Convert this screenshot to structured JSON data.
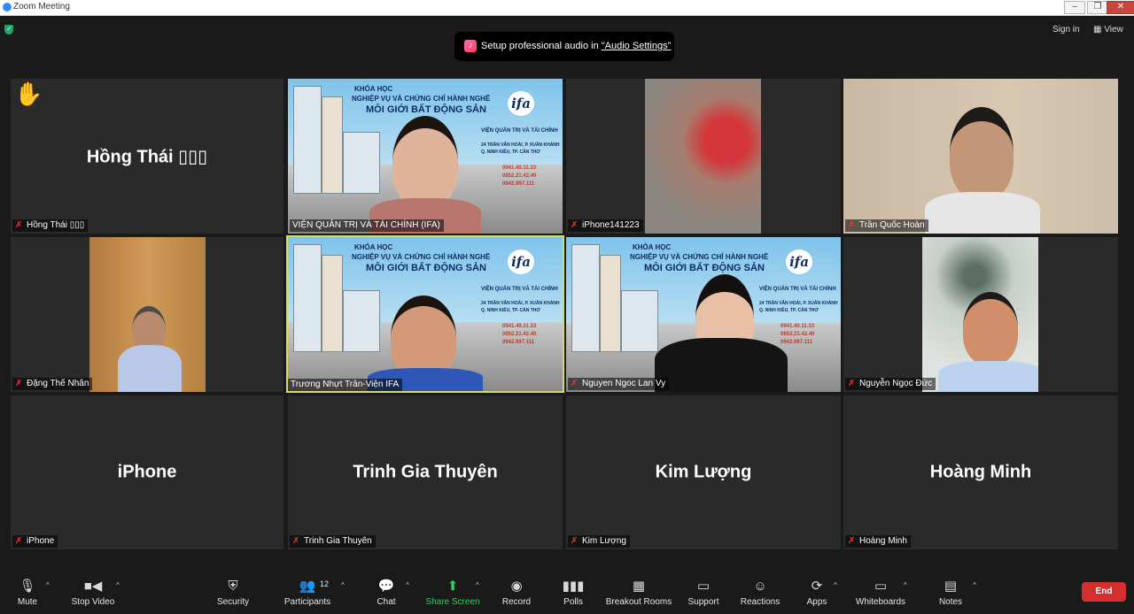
{
  "window": {
    "title": "Zoom Meeting"
  },
  "topbar": {
    "toast_text": "Setup professional audio in ",
    "toast_link": "\"Audio Settings\"",
    "sign_in": "Sign in",
    "view": "View"
  },
  "tiles": [
    {
      "id": "hong-thai",
      "big_name": "Hồng Thái ▯▯▯",
      "tag": "Hồng Thái ▯▯▯"
    },
    {
      "id": "vien-quan-tri",
      "tag": "VIỆN QUẢN TRỊ VÀ TÀI CHÍNH (IFA)"
    },
    {
      "id": "iphone141223",
      "tag": "iPhone141223"
    },
    {
      "id": "tran-quoc-hoan",
      "tag": "Trần Quốc Hoàn"
    },
    {
      "id": "dang-the-nhan",
      "tag": "Đặng Thế Nhân"
    },
    {
      "id": "truong-nhut-tran",
      "tag": "Trương Nhựt Trân-Viện IFA"
    },
    {
      "id": "nguyen-ngoc-lan-vy",
      "tag": "Nguyen Ngoc Lan Vy"
    },
    {
      "id": "nguyen-ngoc-duc",
      "tag": "Nguyễn Ngọc Đức"
    },
    {
      "id": "iphone",
      "big_name": "iPhone",
      "tag": "iPhone"
    },
    {
      "id": "trinh-gia-thuyen",
      "big_name": "Trinh Gia Thuyên",
      "tag": "Trinh Gia Thuyên"
    },
    {
      "id": "kim-luong",
      "big_name": "Kim Lượng",
      "tag": "Kim Lượng"
    },
    {
      "id": "hoang-minh",
      "big_name": "Hoàng Minh",
      "tag": "Hoàng Minh"
    }
  ],
  "ifa_slide": {
    "course": "KHÓA HỌC",
    "line1": "NGHIỆP VỤ VÀ CHỨNG CHỈ HÀNH NGHỀ",
    "line2": "MÔI GIỚI BẤT ĐỘNG SẢN",
    "logo": "ifa",
    "institute": "VIỆN QUẢN TRỊ VÀ TÀI CHÍNH",
    "address1": "24 TRẦN VĂN HOÀI, P. XUÂN KHÁNH",
    "address2": "Q. NINH KIỀU, TP. CẦN THƠ",
    "phone1": "0941.40.11.33",
    "phone2": "0852.21.42.40",
    "phone3": "0942.997.111"
  },
  "toolbar": {
    "mute": "Mute",
    "stop_video": "Stop Video",
    "security": "Security",
    "participants": "Participants",
    "participants_count": "12",
    "chat": "Chat",
    "share_screen": "Share Screen",
    "record": "Record",
    "polls": "Polls",
    "breakout_rooms": "Breakout Rooms",
    "support": "Support",
    "reactions": "Reactions",
    "apps": "Apps",
    "whiteboards": "Whiteboards",
    "notes": "Notes",
    "end": "End"
  },
  "colors": {
    "accent_green": "#2ed15c",
    "end_red": "#d42e2e",
    "active_speaker": "#d7dc5a",
    "tile_bg": "#2a2a2a"
  }
}
